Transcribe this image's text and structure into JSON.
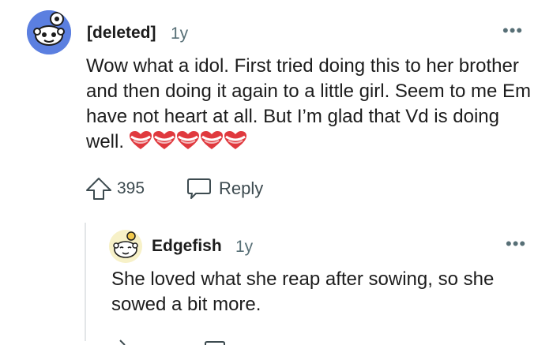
{
  "comment": {
    "author": "[deleted]",
    "age": "1y",
    "more_icon": "more-horizontal-icon",
    "body": "Wow what a idol. First tried doing this to her brother and then doing it again to a little girl. Seem to me Em have not heart at all. But I’m glad that Vd is doing well.",
    "emoji": "heart-stack-emoji x5",
    "votes": "395",
    "reply_label": "Reply"
  },
  "reply": {
    "author": "Edgefish",
    "age": "1y",
    "more_icon": "more-horizontal-icon",
    "body": "She loved what she reap after sowing, so she sowed a bit more."
  },
  "colors": {
    "text": "#1c1c1c",
    "meta": "#576f76",
    "avatar_blue": "#5b7fe0",
    "heart_red": "#e0393e",
    "thread_line": "#e3e6e8"
  }
}
